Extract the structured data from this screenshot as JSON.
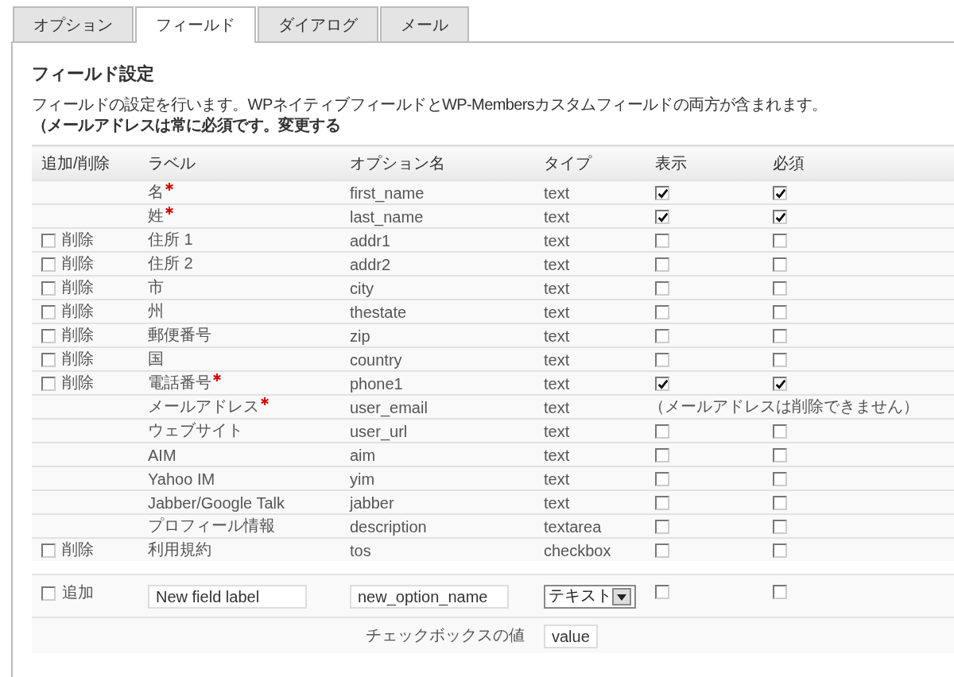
{
  "tabs": [
    {
      "label": "オプション",
      "selected": false
    },
    {
      "label": "フィールド",
      "selected": true
    },
    {
      "label": "ダイアログ",
      "selected": false
    },
    {
      "label": "メール",
      "selected": false
    }
  ],
  "heading": "フィールド設定",
  "description": {
    "text": "フィールドの設定を行います。WPネイティブフィールドとWP-Membersカスタムフィールドの両方が含まれます。",
    "note": "（メールアドレスは常に必須です。変更する"
  },
  "table": {
    "columns": [
      "追加/削除",
      "ラベル",
      "オプション名",
      "タイプ",
      "表示",
      "必須"
    ],
    "rows": [
      {
        "label": "名",
        "starred": true,
        "option": "first_name",
        "type": "text",
        "shown": true,
        "required": true
      },
      {
        "label": "姓",
        "starred": true,
        "option": "last_name",
        "type": "text",
        "shown": true,
        "required": true
      },
      {
        "remove": {
          "label": "削除",
          "checked": false
        },
        "label": "住所 1",
        "starred": false,
        "option": "addr1",
        "type": "text",
        "shown": false,
        "required": false
      },
      {
        "remove": {
          "label": "削除",
          "checked": false
        },
        "label": "住所 2",
        "starred": false,
        "option": "addr2",
        "type": "text",
        "shown": false,
        "required": false
      },
      {
        "remove": {
          "label": "削除",
          "checked": false
        },
        "label": "市",
        "starred": false,
        "option": "city",
        "type": "text",
        "shown": false,
        "required": false
      },
      {
        "remove": {
          "label": "削除",
          "checked": false
        },
        "label": "州",
        "starred": false,
        "option": "thestate",
        "type": "text",
        "shown": false,
        "required": false
      },
      {
        "remove": {
          "label": "削除",
          "checked": false
        },
        "label": "郵便番号",
        "starred": false,
        "option": "zip",
        "type": "text",
        "shown": false,
        "required": false
      },
      {
        "remove": {
          "label": "削除",
          "checked": false
        },
        "label": "国",
        "starred": false,
        "option": "country",
        "type": "text",
        "shown": false,
        "required": false
      },
      {
        "remove": {
          "label": "削除",
          "checked": false
        },
        "label": "電話番号",
        "starred": true,
        "option": "phone1",
        "type": "text",
        "shown": true,
        "required": true
      },
      {
        "label": "メールアドレス",
        "starred": true,
        "option": "user_email",
        "type": "text",
        "note": "（メールアドレスは削除できません）"
      },
      {
        "label": "ウェブサイト",
        "starred": false,
        "option": "user_url",
        "type": "text",
        "shown": false,
        "required": false
      },
      {
        "label": "AIM",
        "starred": false,
        "option": "aim",
        "type": "text",
        "shown": false,
        "required": false
      },
      {
        "label": "Yahoo IM",
        "starred": false,
        "option": "yim",
        "type": "text",
        "shown": false,
        "required": false
      },
      {
        "label": "Jabber/Google Talk",
        "starred": false,
        "option": "jabber",
        "type": "text",
        "shown": false,
        "required": false
      },
      {
        "label": "プロフィール情報",
        "starred": false,
        "option": "description",
        "type": "textarea",
        "shown": false,
        "required": false
      },
      {
        "remove": {
          "label": "削除",
          "checked": false
        },
        "label": "利用規約",
        "starred": false,
        "option": "tos",
        "type": "checkbox",
        "shown": false,
        "required": false
      }
    ]
  },
  "add_row": {
    "add": {
      "label": "追加",
      "checked": false
    },
    "label_value": "New field label",
    "option_value": "new_option_name",
    "type_value": "テキスト",
    "shown": false,
    "required": false,
    "checkbox_value_label": "チェックボックスの値",
    "checkbox_value": "value"
  }
}
